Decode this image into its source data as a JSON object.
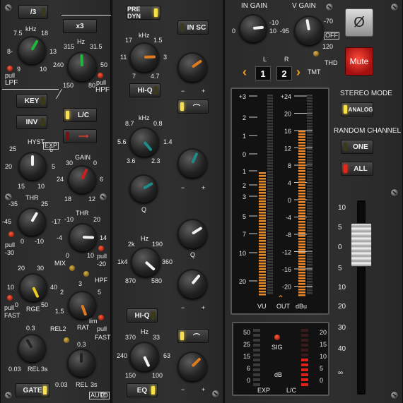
{
  "left": {
    "btn_div3": "/3",
    "btn_x3": "x3",
    "filter_lpf": {
      "khz": "kHz",
      "t1": "7.5",
      "t2": "18",
      "l": "8-",
      "r": "13",
      "b1": "9",
      "b2": "10",
      "pull": "pull",
      "name": "LPF"
    },
    "filter_hpf": {
      "hz": "Hz",
      "t1": "315",
      "t2": "31.5",
      "l": "240",
      "r": "50",
      "b1": "150",
      "b2": "80",
      "pull": "pull",
      "name": "HPF"
    },
    "btn_key": "KEY",
    "btn_inv": "INV",
    "btn_lc": "L/C",
    "hyst": {
      "name": "HYST",
      "exp": "EXP",
      "l": "20",
      "r": "5",
      "tl": "25",
      "tr": "6",
      "b1": "15",
      "b2": "10"
    },
    "gain": {
      "name": "GAIN",
      "t1": "30",
      "t2": "0",
      "l": "24",
      "r": "6",
      "b1": "18",
      "b2": "12"
    },
    "thr1": {
      "name": "THR",
      "t1": "-35",
      "t2": "25",
      "l": "-45",
      "r": "-17",
      "b1": "0",
      "b2": "-10",
      "pull": "pull",
      "pv": "-30"
    },
    "thr2": {
      "name": "THR",
      "t1": "-10",
      "t2": "20",
      "l": "-4",
      "r": "14",
      "b1": "0",
      "b2": "10",
      "pull": "pull",
      "pv": "-20"
    },
    "mix": "MIX",
    "hpf": "HPF",
    "rge": {
      "name": "RGE",
      "t1": "20",
      "t2": "30",
      "l": "10",
      "r": "40",
      "b1": "0",
      "b2": "50",
      "pull": "pull",
      "pv": "FAST"
    },
    "rat": {
      "name": "RAT",
      "t1": "3",
      "l": "2",
      "r": "5",
      "b1": "1.5",
      "b2": "lim",
      "pull": "pull",
      "pv": "FAST"
    },
    "rel1": {
      "t1": "0.3",
      "l": "0.03",
      "b": "REL",
      "r": "3s"
    },
    "rel2": {
      "t1": "0.3",
      "l": "0.03",
      "b": "REL",
      "r": "3s",
      "rel2": "REL2"
    },
    "btn_gate": "GATE",
    "auto": "AUTO"
  },
  "mid": {
    "btn_predyn": "PRE DYN",
    "btn_insc": "IN SC",
    "k1": {
      "khz": "kHz",
      "t1": "17",
      "t2": "1.5",
      "l": "11",
      "r": "3",
      "b1": "7",
      "b2": "4.7"
    },
    "hiq1": "HI-Q",
    "k2": {
      "khz": "kHz",
      "t1": "8.7",
      "t2": "0.8",
      "l": "5.6",
      "r": "1.4",
      "b1": "3.6",
      "b2": "2.3"
    },
    "q1": "Q",
    "k3": {
      "hz": "Hz",
      "t1": "2k",
      "t2": "190",
      "l": "1k4",
      "r": "360",
      "b1": "870",
      "b2": "580"
    },
    "q2": "Q",
    "hiq2": "HI-Q",
    "k4": {
      "hz": "Hz",
      "t1": "370",
      "t2": "33",
      "l": "240",
      "r": "63",
      "b1": "150",
      "b2": "100"
    },
    "btn_eq": "EQ"
  },
  "right": {
    "in_gain": {
      "name": "IN GAIN",
      "l": "0",
      "r": "10",
      "b": "-10"
    },
    "v_gain": {
      "name": "V GAIN",
      "l": "-95",
      "r": "-70",
      "b": "120",
      "off": "OFF"
    },
    "L": "L",
    "R": "R",
    "ch1": "1",
    "ch2": "2",
    "tmt": "TMT",
    "thd": "THD",
    "phase": "Ø",
    "mute": "Mute",
    "stereo_mode": "STEREO MODE",
    "analog": "ANALOG",
    "random_channel": "RANDOM CHANNEL",
    "one": "ONE",
    "all": "ALL",
    "vu_scale": [
      "+3",
      "2",
      "1",
      "0",
      "1",
      "2",
      "3",
      "5",
      "7",
      "10",
      "20"
    ],
    "vu_scale2": [
      "+24",
      "20",
      "16",
      "12",
      "8",
      "4",
      "0",
      "-4",
      "-8",
      "-12",
      "-16",
      "-20"
    ],
    "vu": "VU",
    "out": "OUT",
    "dbu": "dBu",
    "fader_scale": [
      "10",
      "5",
      "0",
      "5",
      "10",
      "20",
      "30",
      "40",
      "∞"
    ],
    "gr_scale": [
      "50",
      "25",
      "15",
      "6",
      "0"
    ],
    "lc_scale": [
      "20",
      "15",
      "10",
      "5",
      "0"
    ],
    "sig": "SIG",
    "db": "dB",
    "exp": "EXP",
    "lc": "L/C"
  },
  "colors": {
    "green": "#1fb83a",
    "orange": "#e07a1e",
    "red": "#d11d1d",
    "teal": "#1c8c8a",
    "white": "#f2f2f2",
    "yellow": "#f0cc1e",
    "mute": "#c3171a"
  },
  "meter_levels": {
    "vu_left_db": -1.2,
    "vu_right_dbu": 16,
    "exp_level": 0,
    "lc_level": 3
  }
}
